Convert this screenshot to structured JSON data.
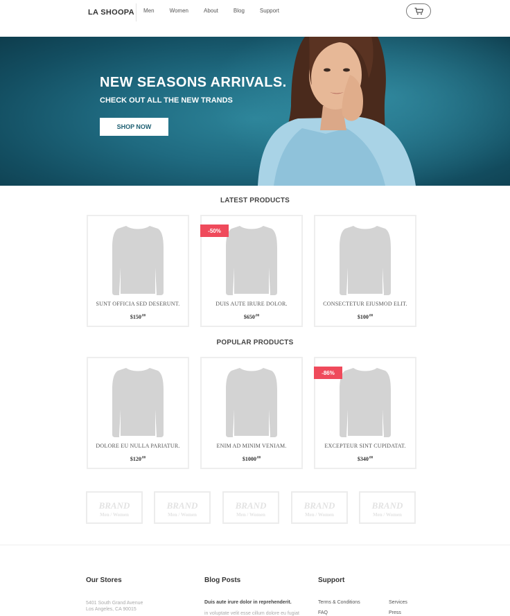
{
  "header": {
    "logo": "LA SHOOPA",
    "nav": [
      "Men",
      "Women",
      "About",
      "Blog",
      "Support"
    ]
  },
  "hero": {
    "title": "NEW SEASONS ARRIVALS.",
    "subtitle": "CHECK OUT ALL THE NEW TRANDS",
    "button": "SHOP NOW"
  },
  "latest": {
    "title": "LATEST PRODUCTS",
    "products": [
      {
        "name": "SUNT OFFICIA SED DESERUNT.",
        "price": "$150",
        "cents": ".00",
        "badge": ""
      },
      {
        "name": "DUIS AUTE IRURE DOLOR.",
        "price": "$650",
        "cents": ".00",
        "badge": "-50%"
      },
      {
        "name": "CONSECTETUR EIUSMOD ELIT.",
        "price": "$100",
        "cents": ".00",
        "badge": ""
      }
    ]
  },
  "popular": {
    "title": "POPULAR PRODUCTS",
    "products": [
      {
        "name": "DOLORE EU NULLA PARIATUR.",
        "price": "$120",
        "cents": ".00",
        "badge": ""
      },
      {
        "name": "ENIM AD MINIM VENIAM.",
        "price": "$1000",
        "cents": ".00",
        "badge": ""
      },
      {
        "name": "EXCEPTEUR SINT CUPIDATAT.",
        "price": "$340",
        "cents": ".00",
        "badge": "-86%"
      }
    ]
  },
  "brands": [
    {
      "name": "BRAND",
      "tag": "Men / Women"
    },
    {
      "name": "BRAND",
      "tag": "Men / Women"
    },
    {
      "name": "BRAND",
      "tag": "Men / Women"
    },
    {
      "name": "BRAND",
      "tag": "Men / Women"
    },
    {
      "name": "BRAND",
      "tag": "Men / Women"
    }
  ],
  "footer": {
    "stores": {
      "title": "Our Stores",
      "address1": "5401 South Grand Avenue",
      "address2": "Los Angeles, CA 90015"
    },
    "blog": {
      "title": "Blog Posts",
      "post_title": "Duis aute irure dolor in reprehenderit.",
      "post_excerpt": "in voluptate velit esse cillum dolore eu fugiat"
    },
    "support": {
      "title": "Support",
      "links": [
        "Terms & Conditions",
        "FAQ",
        "Services",
        "Press"
      ]
    }
  },
  "colors": {
    "accent": "#1f6a80",
    "badge": "#ef4a5b",
    "card_border": "#eeeeee"
  },
  "icons": {
    "cart": "cart-icon",
    "product_image": "shirt-icon"
  }
}
